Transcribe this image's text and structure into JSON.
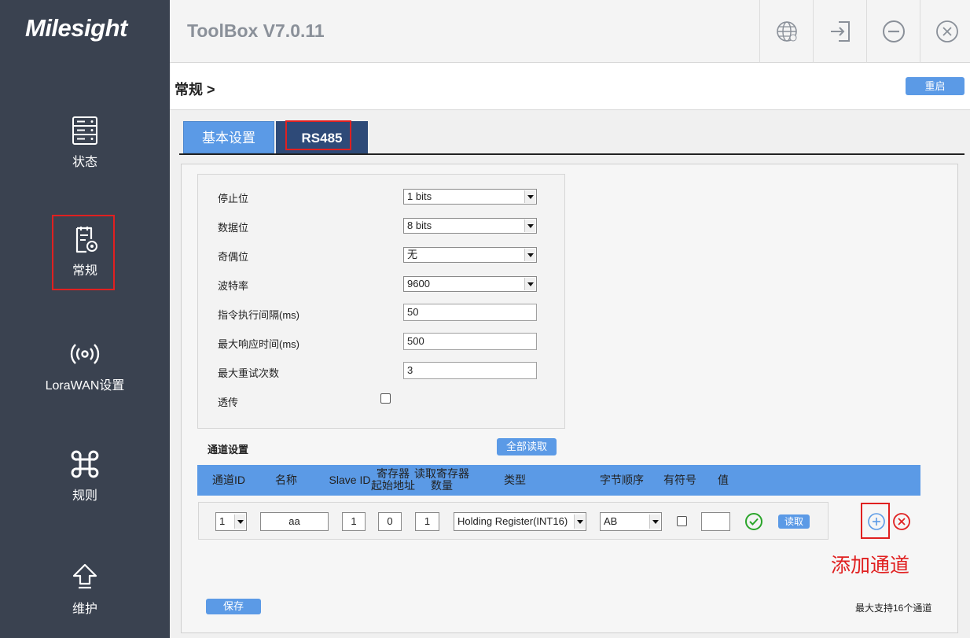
{
  "app": {
    "logo": "Milesight",
    "title": "ToolBox V7.0.11"
  },
  "sidebar": {
    "items": [
      {
        "label": "状态",
        "icon": "server-status-icon"
      },
      {
        "label": "常规",
        "icon": "settings-document-icon"
      },
      {
        "label": "LoraWAN设置",
        "icon": "wireless-broadcast-icon"
      },
      {
        "label": "规则",
        "icon": "command-icon"
      },
      {
        "label": "维护",
        "icon": "upload-arrow-icon"
      }
    ]
  },
  "breadcrumb": {
    "text": "常规 >"
  },
  "toolbar": {
    "restart_label": "重启"
  },
  "tabs": [
    {
      "label": "基本设置"
    },
    {
      "label": "RS485"
    }
  ],
  "rs485": {
    "stop_bits": {
      "label": "停止位",
      "value": "1 bits"
    },
    "data_bits": {
      "label": "数据位",
      "value": "8 bits"
    },
    "parity": {
      "label": "奇偶位",
      "value": "无"
    },
    "baud_rate": {
      "label": "波特率",
      "value": "9600"
    },
    "cmd_interval": {
      "label": "指令执行间隔(ms)",
      "value": "50"
    },
    "max_response": {
      "label": "最大响应时间(ms)",
      "value": "500"
    },
    "max_retry": {
      "label": "最大重试次数",
      "value": "3"
    },
    "passthrough": {
      "label": "透传",
      "checked": false
    }
  },
  "channels": {
    "title": "通道设置",
    "read_all_label": "全部读取",
    "headers": {
      "id": "通道ID",
      "name": "名称",
      "slave_id": "Slave ID",
      "reg_start_1": "寄存器",
      "reg_start_2": "起始地址",
      "read_count_1": "读取寄存器",
      "read_count_2": "数量",
      "type": "类型",
      "byte_order": "字节顺序",
      "signed": "有符号",
      "value": "值"
    },
    "rows": [
      {
        "id": "1",
        "name": "aa",
        "slave_id": "1",
        "reg_start": "0",
        "read_count": "1",
        "type": "Holding Register(INT16)",
        "byte_order": "AB",
        "signed": false,
        "value": "",
        "read_label": "读取"
      }
    ],
    "add_annotation": "添加通道",
    "save_label": "保存",
    "max_note": "最大支持16个通道"
  },
  "colors": {
    "accent": "#5b9ae6",
    "sidebar": "#3a4250",
    "annotation": "#e02020"
  }
}
